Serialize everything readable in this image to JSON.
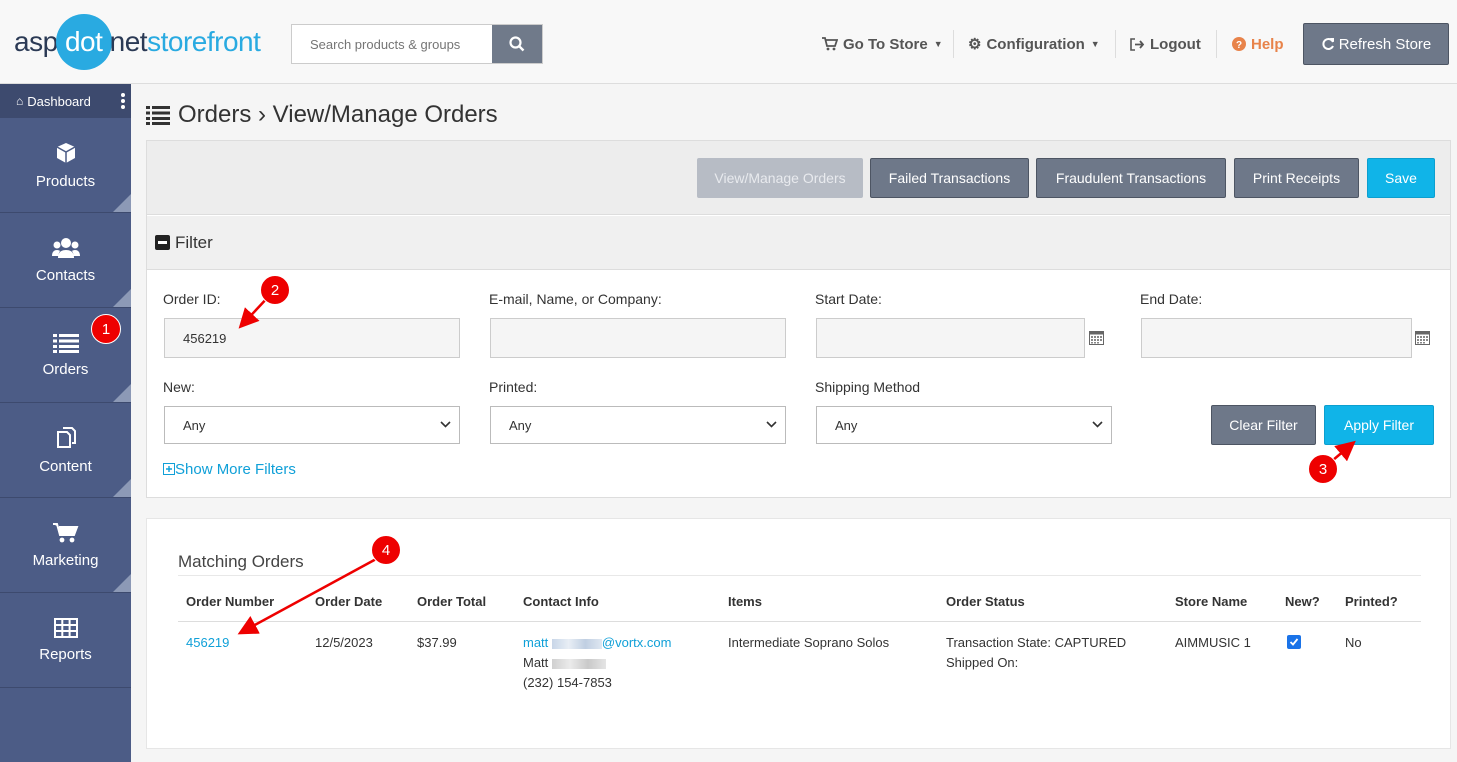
{
  "header": {
    "logo": {
      "part1": "asp",
      "part2": "dot",
      "part3": "net",
      "part4": "storefront"
    },
    "search_placeholder": "Search products & groups",
    "nav": {
      "go_to_store": "Go To Store",
      "configuration": "Configuration",
      "logout": "Logout",
      "help": "Help",
      "refresh_store": "Refresh Store"
    }
  },
  "sidebar": {
    "dashboard": "Dashboard",
    "items": [
      {
        "label": "Products",
        "icon": "box-icon"
      },
      {
        "label": "Contacts",
        "icon": "users-icon"
      },
      {
        "label": "Orders",
        "icon": "list-icon"
      },
      {
        "label": "Content",
        "icon": "copy-icon"
      },
      {
        "label": "Marketing",
        "icon": "cart-icon"
      },
      {
        "label": "Reports",
        "icon": "table-icon"
      }
    ]
  },
  "page": {
    "title": "Orders › View/Manage Orders",
    "toolbar": {
      "view_manage": "View/Manage Orders",
      "failed": "Failed Transactions",
      "fraudulent": "Fraudulent Transactions",
      "print_receipts": "Print Receipts",
      "save": "Save"
    },
    "filter": {
      "heading": "Filter",
      "order_id_label": "Order ID:",
      "order_id_value": "456219",
      "email_label": "E-mail, Name, or Company:",
      "email_value": "",
      "start_date_label": "Start Date:",
      "start_date_value": "",
      "end_date_label": "End Date:",
      "end_date_value": "",
      "new_label": "New:",
      "new_value": "Any",
      "printed_label": "Printed:",
      "printed_value": "Any",
      "shipping_label": "Shipping Method",
      "shipping_value": "Any",
      "clear": "Clear Filter",
      "apply": "Apply Filter",
      "show_more": "Show More Filters"
    },
    "results": {
      "title": "Matching Orders",
      "columns": [
        "Order Number",
        "Order Date",
        "Order Total",
        "Contact Info",
        "Items",
        "Order Status",
        "Store Name",
        "New?",
        "Printed?"
      ],
      "rows": [
        {
          "order_number": "456219",
          "order_date": "12/5/2023",
          "order_total": "$37.99",
          "contact_email_prefix": "matt",
          "contact_email_suffix": "@vortx.com",
          "contact_name": "Matt",
          "contact_phone": "(232) 154-7853",
          "items": "Intermediate Soprano Solos",
          "status_line1": "Transaction State: CAPTURED",
          "status_line2": "Shipped On:",
          "store_name": "AIMMUSIC 1",
          "new": true,
          "printed": "No"
        }
      ]
    }
  },
  "annotations": [
    "1",
    "2",
    "3",
    "4"
  ],
  "colors": {
    "accent": "#10b4e8",
    "sidebar": "#4c5c86",
    "annotation": "#ee0000",
    "help": "#e8834a"
  }
}
